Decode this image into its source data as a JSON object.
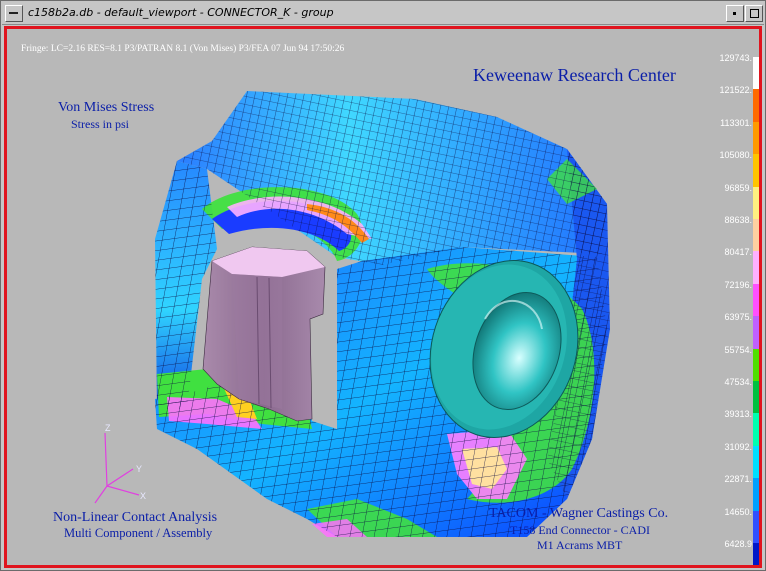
{
  "window": {
    "title": "c158b2a.db - default_viewport - CONNECTOR_K - group"
  },
  "viewport": {
    "range_line": "Fringe: LC=2.16  RES=8.1  P3/PATRAN 8.1  (Von  Mises)  P3/FEA  07  Jun  94 17:50:26",
    "organization": "Keweenaw Research Center",
    "result_title": "Von Mises Stress",
    "result_units": "Stress in psi",
    "analysis_title": "Non-Linear Contact Analysis",
    "analysis_subtitle": "Multi Component / Assembly",
    "customer_title": "TACOM - Wagner Castings Co.",
    "customer_line1": "T158 End Connector - CADI",
    "customer_line2": "M1 Acrams MBT",
    "axis_labels": {
      "z": "Z",
      "y": "Y",
      "x": "X"
    }
  },
  "legend": {
    "values": [
      "129743.",
      "121522.",
      "113301.",
      "105080.",
      "96859.",
      "88638.",
      "80417.",
      "72196.",
      "63975.",
      "55754.",
      "47534.",
      "39313.",
      "31092.",
      "22871.",
      "14650.",
      "6428.9"
    ],
    "colors": [
      "#ffffff",
      "#ff6a00",
      "#ff9a00",
      "#ffc400",
      "#fff080",
      "#ffd0a0",
      "#ffb0ff",
      "#ff50ff",
      "#c060ff",
      "#50e000",
      "#00c040",
      "#00ffb0",
      "#00e0ff",
      "#00a0ff",
      "#3050ff",
      "#0018c8"
    ]
  },
  "colors": {
    "border_red": "#e0141e",
    "text_blue": "#0a1ea8",
    "background": "#b8b8b8"
  },
  "icons": {
    "window_menu": "window-menu-icon",
    "minimize": "minimize-icon",
    "maximize": "maximize-icon"
  }
}
